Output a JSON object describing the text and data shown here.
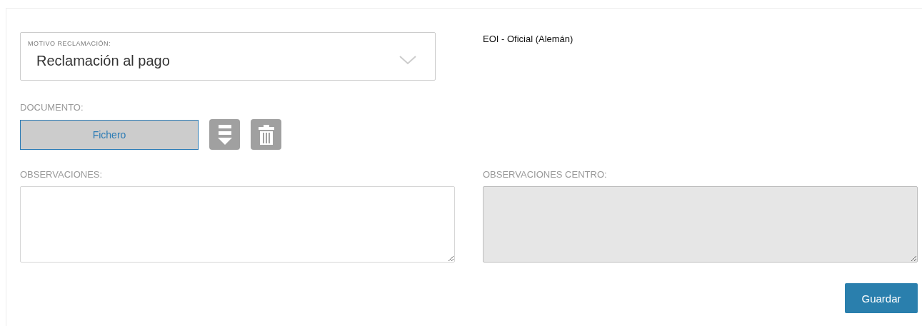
{
  "motivo": {
    "label": "MOTIVO RECLAMACIÓN:",
    "value": "Reclamación al pago"
  },
  "curso": "EOI - Oficial (Alemán)",
  "documento": {
    "label": "DOCUMENTO:",
    "file_button": "Fichero"
  },
  "observaciones": [
    {
      "label": "OBSERVACIONES:",
      "disabled": false
    },
    {
      "label": "OBSERVACIONES CENTRO:",
      "disabled": true
    }
  ],
  "save_button": "Guardar"
}
